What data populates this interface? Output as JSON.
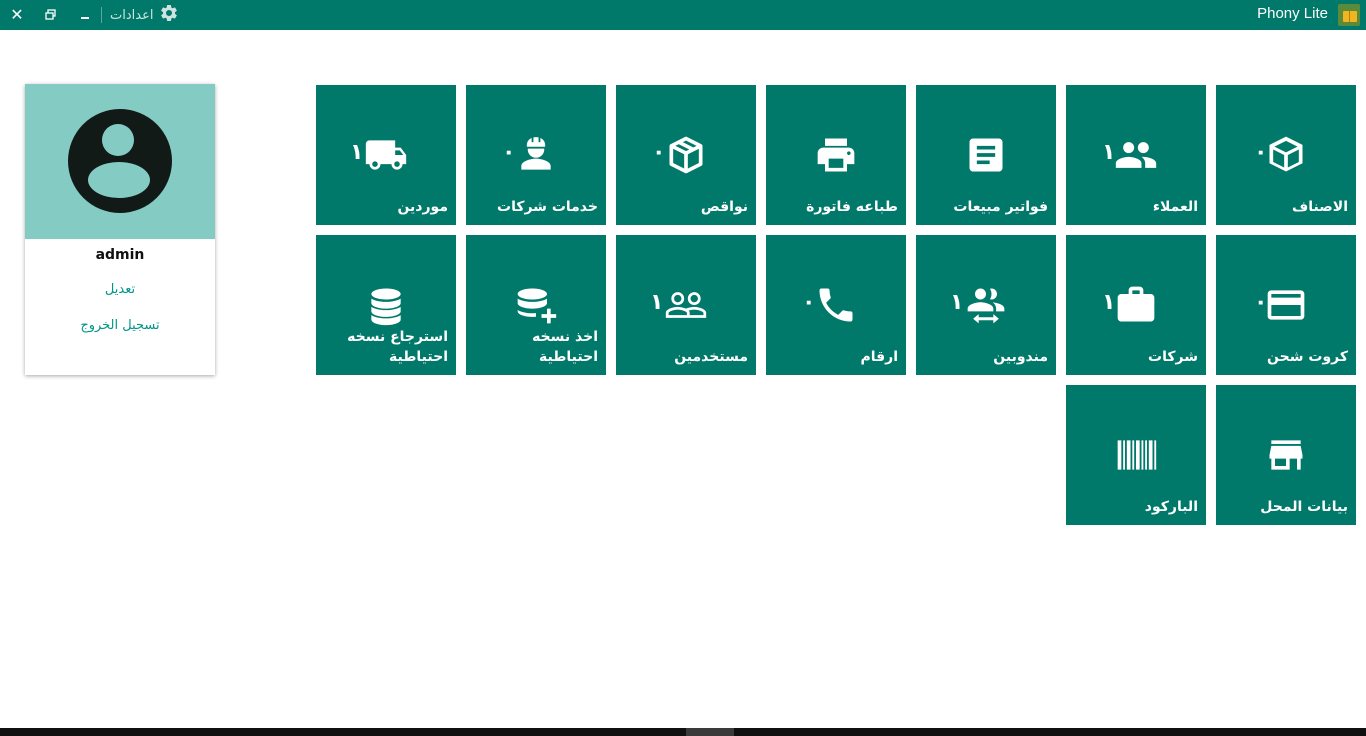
{
  "titlebar": {
    "app_title": "Phony Lite",
    "settings_label": "اعدادات",
    "close_icon": "close-icon",
    "restore_icon": "restore-icon",
    "minimize_icon": "minimize-icon",
    "settings_icon": "gear-icon",
    "background": "#00796b"
  },
  "profile": {
    "username": "admin",
    "edit_label": "تعديل",
    "logout_label": "تسجيل الخروج",
    "avatar_icon": "avatar-icon",
    "photo_background": "#84cbc4",
    "link_color": "#009688"
  },
  "tiles": [
    {
      "id": "categories",
      "label": "الاصناف",
      "badge": "٠",
      "icon": "box-open-icon"
    },
    {
      "id": "customers",
      "label": "العملاء",
      "badge": "١",
      "icon": "people-icon"
    },
    {
      "id": "sales-invoices",
      "label": "فواتير مبيعات",
      "badge": "",
      "icon": "document-icon"
    },
    {
      "id": "print-invoice",
      "label": "طباعه فاتورة",
      "badge": "",
      "icon": "printer-icon"
    },
    {
      "id": "shortages",
      "label": "نواقص",
      "badge": "٠",
      "icon": "package-icon"
    },
    {
      "id": "company-services",
      "label": "خدمات شركات",
      "badge": "٠",
      "icon": "engineer-icon"
    },
    {
      "id": "suppliers",
      "label": "موردين",
      "badge": "١",
      "icon": "truck-icon"
    },
    {
      "id": "charge-cards",
      "label": "كروت شحن",
      "badge": "٠",
      "icon": "credit-card-icon"
    },
    {
      "id": "companies",
      "label": "شركات",
      "badge": "١",
      "icon": "briefcase-icon"
    },
    {
      "id": "delegates",
      "label": "مندوبين",
      "badge": "١",
      "icon": "people-exchange-icon"
    },
    {
      "id": "numbers",
      "label": "ارقام",
      "badge": "٠",
      "icon": "phone-icon"
    },
    {
      "id": "users",
      "label": "مستخدمين",
      "badge": "١",
      "icon": "people-outline-icon"
    },
    {
      "id": "backup",
      "label": "اخذ نسخه احتياطية",
      "badge": "",
      "icon": "database-plus-icon"
    },
    {
      "id": "restore-backup",
      "label": "استرجاع نسخه احتياطية",
      "badge": "",
      "icon": "database-icon"
    },
    {
      "id": "shop-data",
      "label": "بيانات المحل",
      "badge": "",
      "icon": "store-icon"
    },
    {
      "id": "barcode",
      "label": "الباركود",
      "badge": "",
      "icon": "barcode-icon"
    }
  ],
  "colors": {
    "tile_background": "#00796b",
    "tile_text": "#ffffff"
  }
}
